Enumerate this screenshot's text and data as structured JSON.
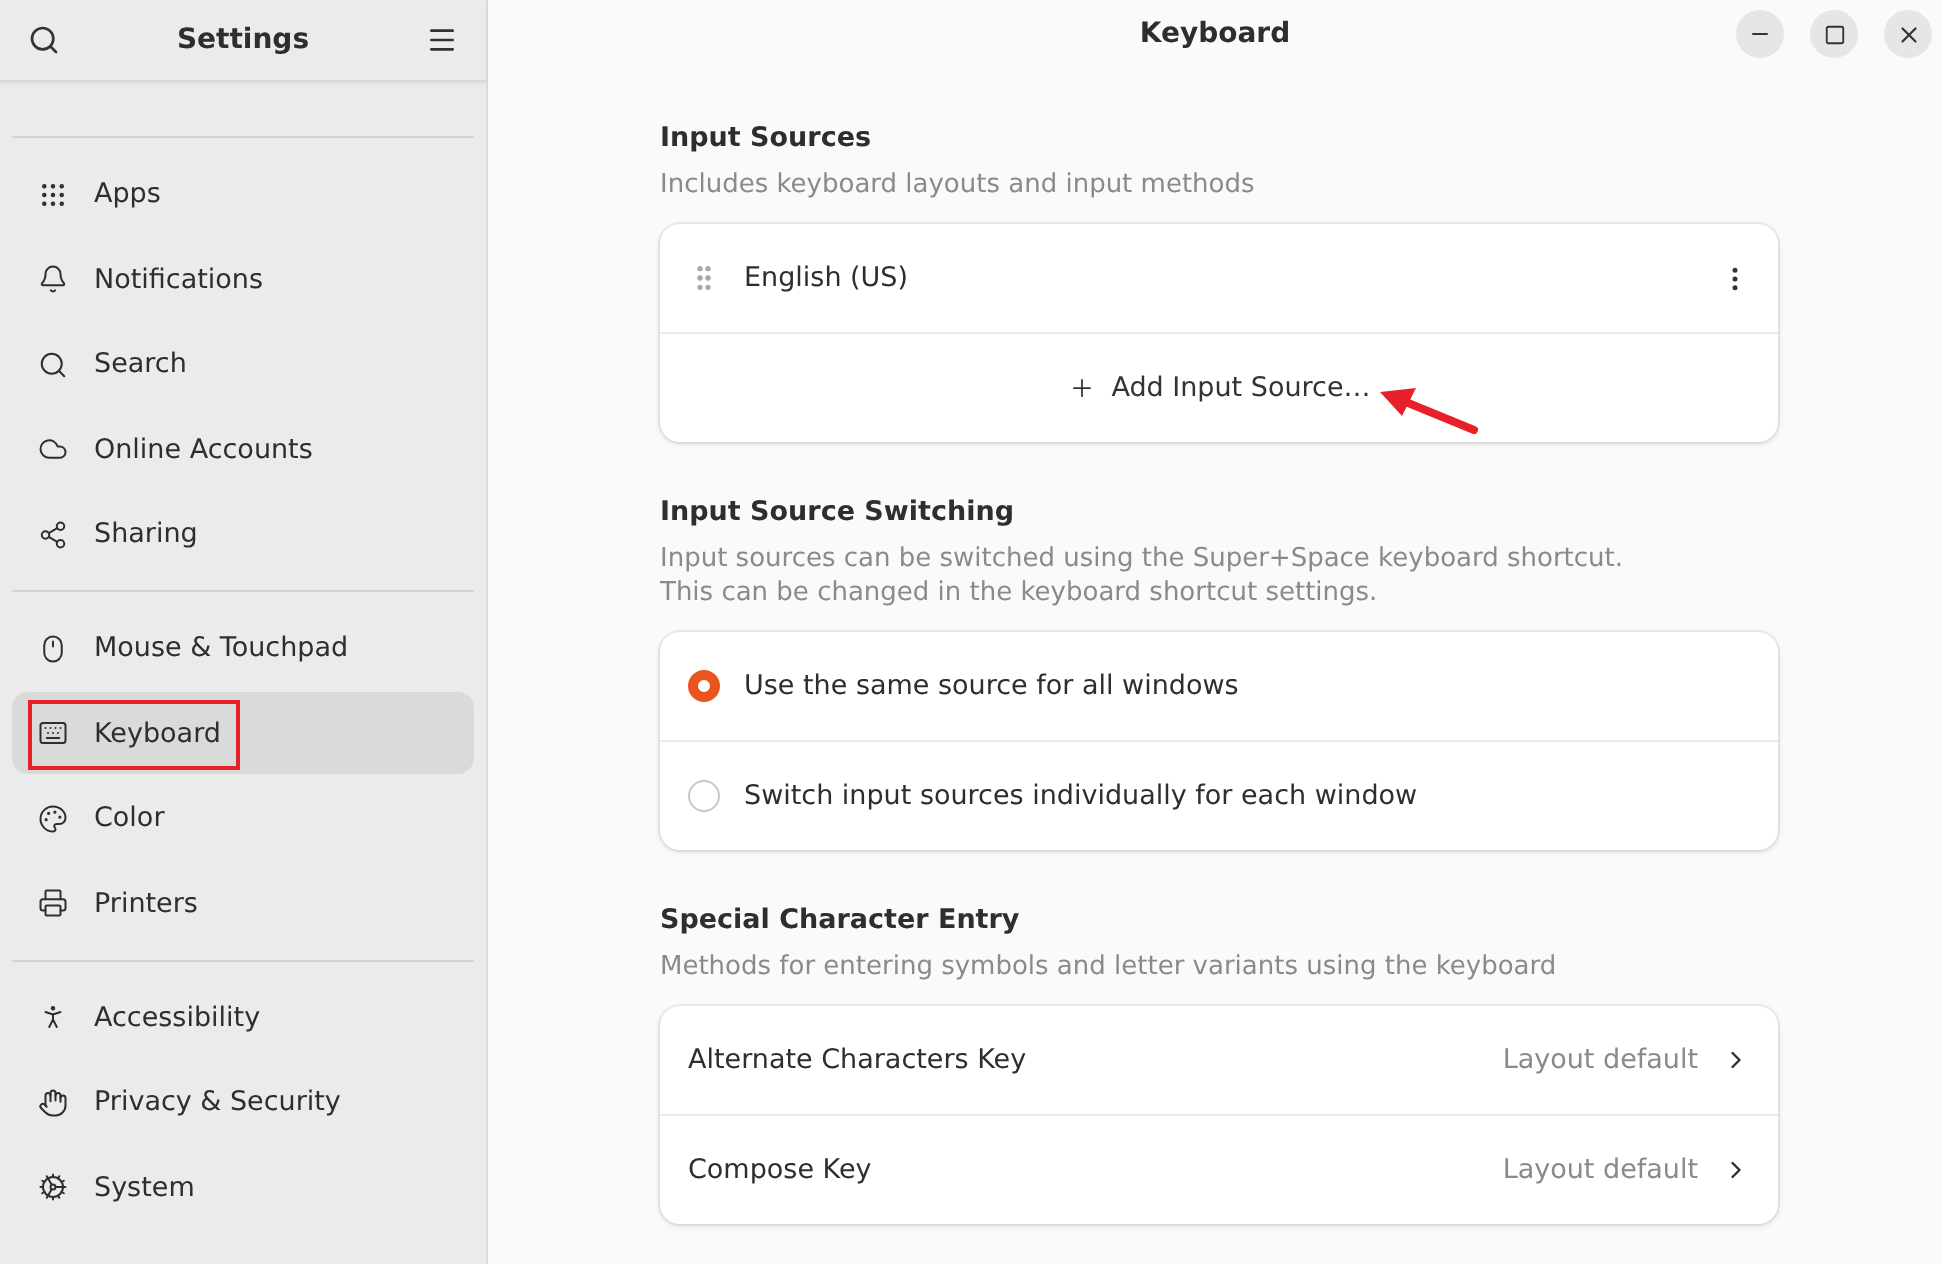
{
  "sidebar": {
    "title": "Settings",
    "groups": [
      {
        "items": [
          {
            "label": "Apps",
            "selected": false
          },
          {
            "label": "Notifications",
            "selected": false
          },
          {
            "label": "Search",
            "selected": false
          },
          {
            "label": "Online Accounts",
            "selected": false
          },
          {
            "label": "Sharing",
            "selected": false
          }
        ]
      },
      {
        "items": [
          {
            "label": "Mouse & Touchpad",
            "selected": false
          },
          {
            "label": "Keyboard",
            "selected": true
          },
          {
            "label": "Color",
            "selected": false
          },
          {
            "label": "Printers",
            "selected": false
          }
        ]
      },
      {
        "items": [
          {
            "label": "Accessibility",
            "selected": false
          },
          {
            "label": "Privacy & Security",
            "selected": false
          },
          {
            "label": "System",
            "selected": false
          }
        ]
      }
    ]
  },
  "window": {
    "title": "Keyboard"
  },
  "input_sources": {
    "title": "Input Sources",
    "description": "Includes keyboard layouts and input methods",
    "sources": [
      "English (US)"
    ],
    "add_button": "Add Input Source…"
  },
  "switching": {
    "title": "Input Source Switching",
    "description": [
      "Input sources can be switched using the Super+Space keyboard shortcut.",
      "This can be changed in the keyboard shortcut settings."
    ],
    "options": [
      {
        "label": "Use the same source for all windows",
        "selected": true
      },
      {
        "label": "Switch input sources individually for each window",
        "selected": false
      }
    ]
  },
  "special_characters": {
    "title": "Special Character Entry",
    "description": "Methods for entering symbols and letter variants using the keyboard",
    "rows": [
      {
        "label": "Alternate Characters Key",
        "value": "Layout default"
      },
      {
        "label": "Compose Key",
        "value": "Layout default"
      }
    ]
  }
}
